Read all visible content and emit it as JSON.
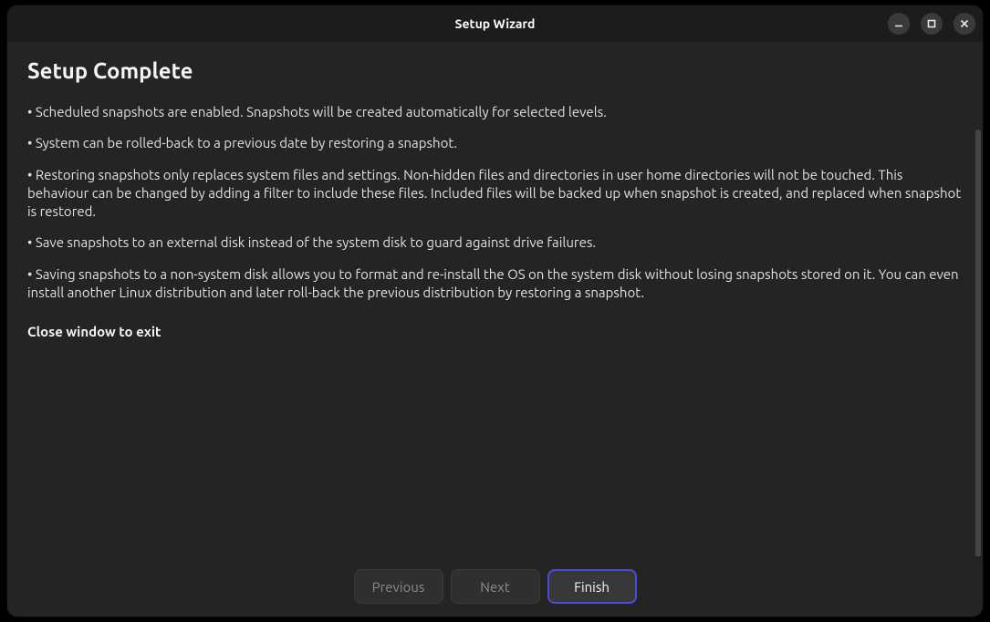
{
  "window": {
    "title": "Setup Wizard"
  },
  "page": {
    "heading": "Setup Complete",
    "bullets": [
      "Scheduled snapshots are enabled. Snapshots will be created automatically for selected levels.",
      "System can be rolled-back to a previous date by restoring a snapshot.",
      "Restoring snapshots only replaces system files and settings. Non-hidden files and directories in user home directories will not be touched. This behaviour can be changed by adding a filter to include these files. Included files will be backed up when snapshot is created, and replaced when snapshot is restored.",
      "Save snapshots to an external disk instead of the system disk to guard against drive failures.",
      "Saving snapshots to a non-system disk allows you to format and re-install the OS on the system disk without losing snapshots stored on it. You can even install another Linux distribution and later roll-back the previous distribution by restoring a snapshot."
    ],
    "exit_note": "Close window to exit"
  },
  "footer": {
    "previous": "Previous",
    "next": "Next",
    "finish": "Finish"
  }
}
